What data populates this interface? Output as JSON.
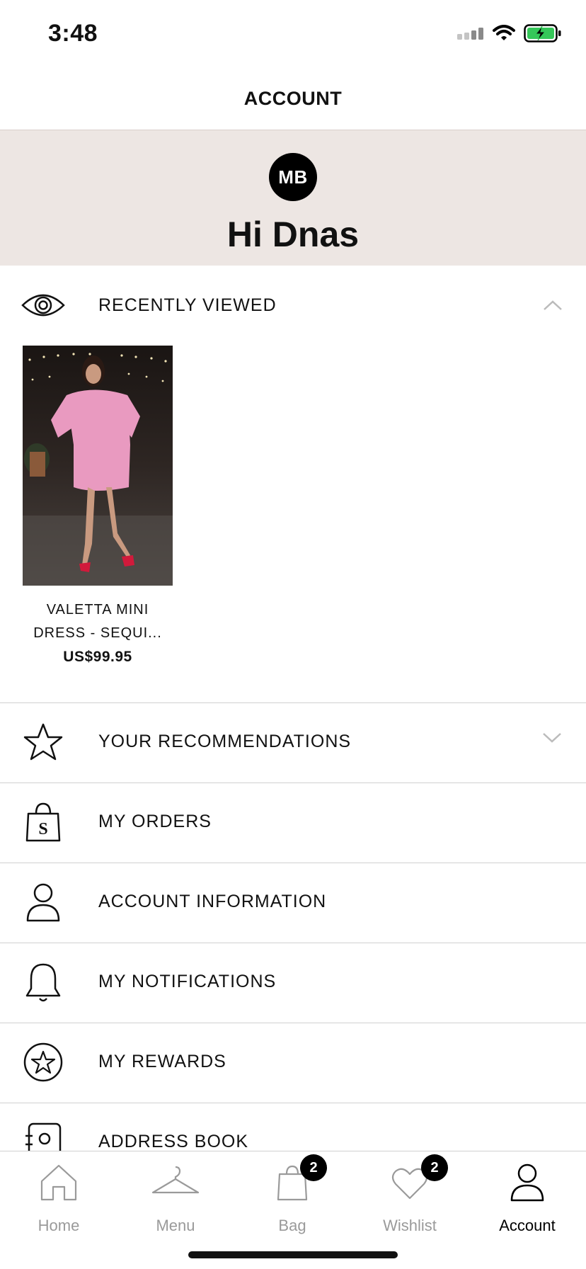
{
  "status_bar": {
    "time": "3:48"
  },
  "header": {
    "title": "ACCOUNT"
  },
  "greeting": {
    "avatar_initials": "MB",
    "text": "Hi Dnas"
  },
  "recently_viewed": {
    "label": "RECENTLY VIEWED",
    "products": [
      {
        "name_line1": "VALETTA MINI",
        "name_line2": "DRESS - SEQUI...",
        "price": "US$99.95"
      }
    ]
  },
  "menu": {
    "recommendations": "YOUR RECOMMENDATIONS",
    "orders": "MY ORDERS",
    "account_info": "ACCOUNT INFORMATION",
    "notifications": "MY NOTIFICATIONS",
    "rewards": "MY REWARDS",
    "address_book": "ADDRESS BOOK"
  },
  "tab_bar": {
    "home": "Home",
    "menu": "Menu",
    "bag": "Bag",
    "bag_count": "2",
    "wishlist": "Wishlist",
    "wishlist_count": "2",
    "account": "Account"
  },
  "colors": {
    "greeting_bg": "#ede6e3",
    "accent": "#000000",
    "battery": "#35c759"
  }
}
